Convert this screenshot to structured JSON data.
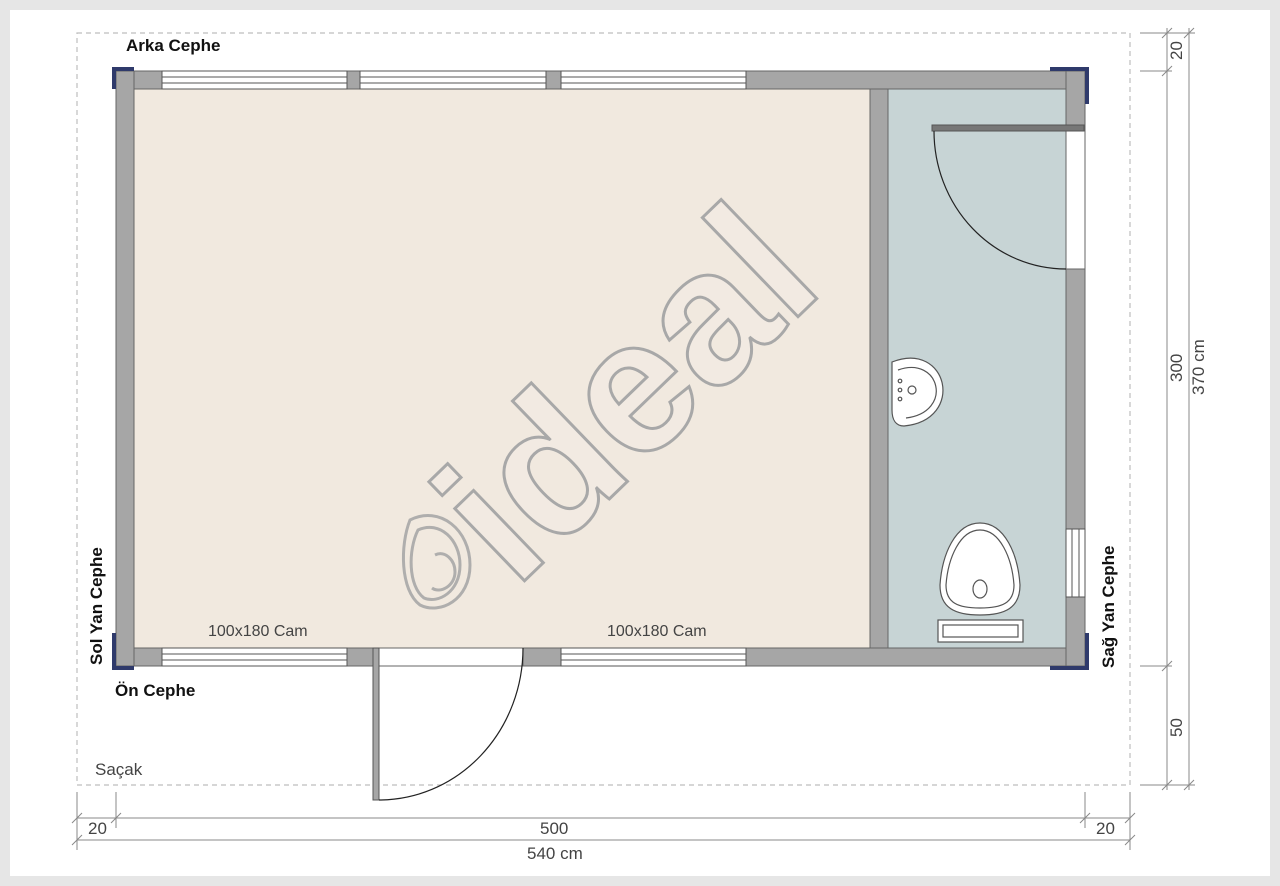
{
  "labels": {
    "back_facade": "Arka Cephe",
    "front_facade": "Ön Cephe",
    "left_facade": "Sol Yan Cephe",
    "right_facade": "Sağ Yan Cephe",
    "eave": "Saçak",
    "window_left": "100x180 Cam",
    "window_right": "100x180 Cam"
  },
  "dimensions": {
    "width_left_overhang": "20",
    "width_inner": "500",
    "width_right_overhang": "20",
    "width_total": "540 cm",
    "depth_top": "20",
    "depth_inner": "300",
    "depth_bottom": "50",
    "depth_total": "370 cm"
  },
  "watermark": {
    "text": "ideal"
  },
  "colors": {
    "room_floor": "#f1e9df",
    "wc_floor": "#c7d4d5",
    "wall": "#a6a6a6",
    "corner_post": "#2f3a6b",
    "page": "#ffffff",
    "background": "#e6e6e6"
  }
}
